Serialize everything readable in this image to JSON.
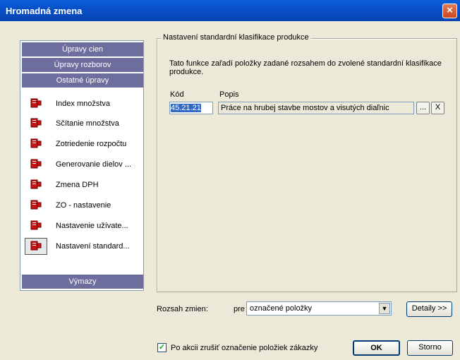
{
  "window": {
    "title": "Hromadná zmena",
    "close_glyph": "×"
  },
  "sidebar": {
    "groups": [
      "Úpravy cien",
      "Úpravy rozborov",
      "Ostatné úpravy",
      "Výmazy"
    ],
    "items": [
      {
        "label": "Index množstva",
        "icon": "edit-doc-icon"
      },
      {
        "label": "Sčítanie množstva",
        "icon": "edit-doc-icon"
      },
      {
        "label": "Zotriedenie rozpočtu",
        "icon": "edit-doc-icon"
      },
      {
        "label": "Generovanie dielov ...",
        "icon": "edit-doc-icon"
      },
      {
        "label": "Zmena DPH",
        "icon": "edit-doc-icon"
      },
      {
        "label": "ZO - nastavenie",
        "icon": "edit-doc-icon"
      },
      {
        "label": "Nastavenie užívate...",
        "icon": "edit-doc-icon"
      },
      {
        "label": "Nastavení standard...",
        "icon": "edit-doc-icon",
        "selected": true
      }
    ]
  },
  "panel": {
    "group_title": "Nastavení standardní klasifikace produkce",
    "description": "Tato funkce zařadí položky zadané rozsahem do zvolené standardní klasifikace produkce.",
    "code_label": "Kód",
    "popis_label": "Popis",
    "code_value": "45.21.21",
    "popis_value": "Práce na hrubej stavbe mostov a visutých diaľnic",
    "browse_label": "...",
    "clear_label": "X"
  },
  "footer": {
    "range_label": "Rozsah zmien:",
    "pre_label": "pre",
    "range_value": "označené položky",
    "details_label": "Detaily >>",
    "checkbox_label": "Po akcii zrušiť označenie položiek zákazky",
    "checkbox_checked": true,
    "ok_label": "OK",
    "cancel_label": "Storno"
  },
  "colors": {
    "titlebar": "#0a5fd8",
    "group_header": "#6d6e9e",
    "icon_red": "#cc1111"
  }
}
